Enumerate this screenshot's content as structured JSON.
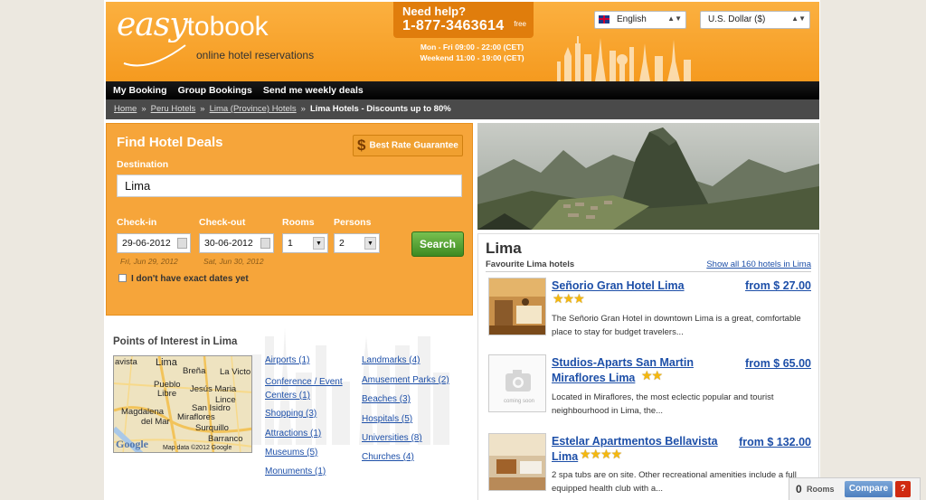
{
  "header": {
    "logo_main": "easy",
    "logo_second": "tobook",
    "logo_tagline": "online hotel reservations",
    "help_title": "Need help?",
    "help_phone": "1-877-3463614",
    "help_free": "free",
    "hours_weekday": "Mon - Fri 09:00 - 22:00 (CET)",
    "hours_weekend": "Weekend 11:00 - 19:00 (CET)",
    "language": "English",
    "currency": "U.S. Dollar ($)"
  },
  "nav": [
    "My Booking",
    "Group Bookings",
    "Send me weekly deals"
  ],
  "breadcrumb": {
    "items": [
      "Home",
      "Peru Hotels",
      "Lima (Province) Hotels"
    ],
    "separator": "»",
    "current": "Lima Hotels - Discounts up to 80%"
  },
  "search": {
    "title": "Find Hotel Deals",
    "best_rate": "Best Rate Guarantee",
    "best_rate_symbol": "$",
    "destination_label": "Destination",
    "destination_value": "Lima",
    "checkin_label": "Check-in",
    "checkin_value": "29-06-2012",
    "checkin_hint": "Fri, Jun 29, 2012",
    "checkout_label": "Check-out",
    "checkout_value": "30-06-2012",
    "checkout_hint": "Sat, Jun 30, 2012",
    "rooms_label": "Rooms",
    "rooms_value": "1",
    "persons_label": "Persons",
    "persons_value": "2",
    "no_dates_label": "I don't have exact dates yet",
    "search_button": "Search"
  },
  "poi": {
    "title": "Points of Interest in Lima",
    "map_labels": [
      "Lima",
      "Breña",
      "La Victo",
      "Pueblo",
      "Libre",
      "Jesús Maria",
      "Lince",
      "San Isidro",
      "Magdalena",
      "del Mar",
      "Miraflores",
      "Surquillo",
      "Barranco",
      "avista"
    ],
    "map_google": "Google",
    "map_copyright": "Map data ©2012 Google",
    "links_col1": [
      "Airports (1)",
      "Conference / Event Centers (1)",
      "Shopping (3)",
      "Attractions (1)",
      "Museums (5)",
      "Monuments (1)"
    ],
    "links_col2": [
      "Landmarks (4)",
      "Amusement Parks (2)",
      "Beaches (3)",
      "Hospitals (5)",
      "Universities (8)",
      "Churches (4)"
    ]
  },
  "favourites": {
    "city": "Lima",
    "subtitle": "Favourite Lima hotels",
    "show_all": "Show all 160 hotels in Lima",
    "hotels": [
      {
        "name": "Señorio Gran Hotel Lima",
        "stars": 3,
        "price": "from $ 27.00",
        "description": "The Señorio Gran Hotel in downtown Lima is a great, comfortable place to stay for budget travelers..."
      },
      {
        "name": "Studios-Aparts San Martin Miraflores Lima",
        "stars": 2,
        "price": "from $ 65.00",
        "description": "Located in Miraflores, the most eclectic popular and tourist neighbourhood in Lima, the...",
        "image_caption": "coming soon"
      },
      {
        "name": "Estelar Apartmentos Bellavista Lima",
        "stars": 4,
        "price": "from $ 132.00",
        "description": "2 spa tubs are on site. Other recreational amenities include a full equipped health club with a..."
      }
    ]
  },
  "compare": {
    "count": "0",
    "rooms_label": "Rooms",
    "button": "Compare",
    "help": "?"
  },
  "colors": {
    "accent_orange": "#f6a53a",
    "link_blue": "#1d4fa8",
    "search_green": "#4a9a2c",
    "star_gold": "#f5b80e"
  }
}
